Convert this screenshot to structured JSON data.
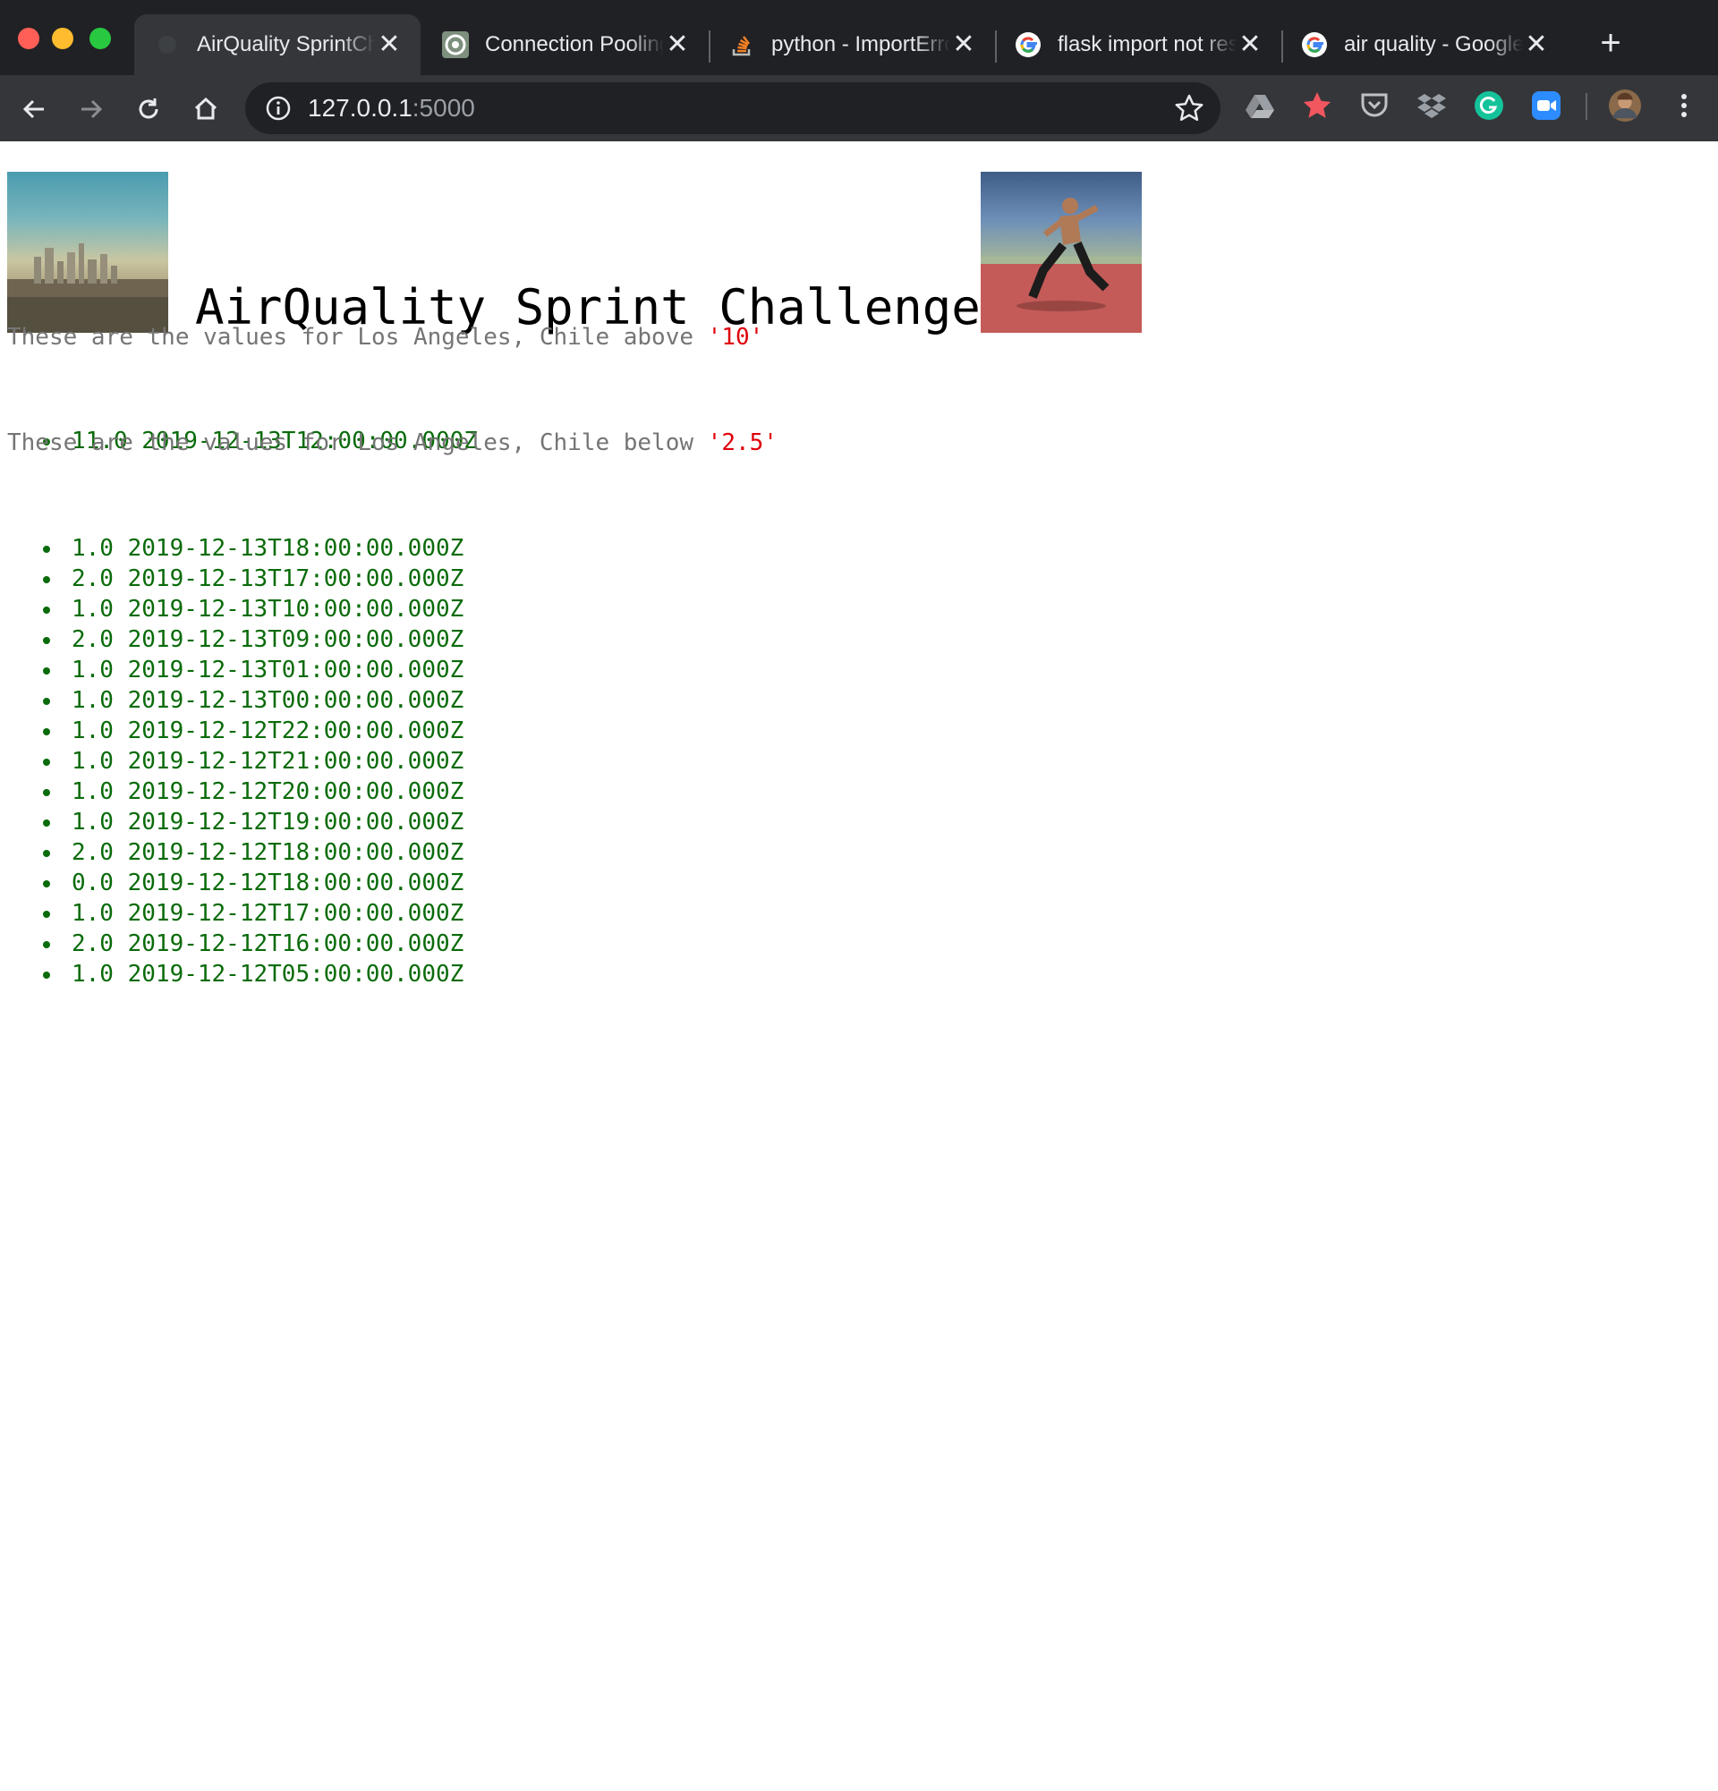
{
  "browser": {
    "tabs": [
      {
        "label": "AirQuality SprintChallenge",
        "active": true,
        "icon": "page-icon"
      },
      {
        "label": "Connection Pooling",
        "active": false,
        "icon": "target-icon"
      },
      {
        "label": "python - ImportError",
        "active": false,
        "icon": "stackoverflow-icon"
      },
      {
        "label": "flask import not resolved",
        "active": false,
        "icon": "google-icon"
      },
      {
        "label": "air quality - Google",
        "active": false,
        "icon": "google-icon"
      }
    ],
    "close_glyph": "✕",
    "new_tab_glyph": "+",
    "url_host": "127.0.0.1",
    "url_port": ":5000",
    "extensions": [
      "drive-icon",
      "bookmark-star-icon",
      "pocket-icon",
      "dropbox-icon",
      "grammarly-icon",
      "zoom-icon",
      "profile-avatar",
      "menu-dots-icon"
    ]
  },
  "page": {
    "heading": "AirQuality Sprint Challenge!",
    "above": {
      "prefix": "These are the values for Los Angeles, Chile above ",
      "threshold": "'10'",
      "items": [
        "11.0 2019-12-13T12:00:00.000Z"
      ]
    },
    "below": {
      "prefix": "These are the values for Los Angeles, Chile below ",
      "threshold": "'2.5'",
      "items": [
        "1.0 2019-12-13T18:00:00.000Z",
        "2.0 2019-12-13T17:00:00.000Z",
        "1.0 2019-12-13T10:00:00.000Z",
        "2.0 2019-12-13T09:00:00.000Z",
        "1.0 2019-12-13T01:00:00.000Z",
        "1.0 2019-12-13T00:00:00.000Z",
        "1.0 2019-12-12T22:00:00.000Z",
        "1.0 2019-12-12T21:00:00.000Z",
        "1.0 2019-12-12T20:00:00.000Z",
        "1.0 2019-12-12T19:00:00.000Z",
        "2.0 2019-12-12T18:00:00.000Z",
        "0.0 2019-12-12T18:00:00.000Z",
        "1.0 2019-12-12T17:00:00.000Z",
        "2.0 2019-12-12T16:00:00.000Z",
        "1.0 2019-12-12T05:00:00.000Z"
      ]
    }
  },
  "colors": {
    "threshold": "#e0000a",
    "value_text": "#0a6b0a",
    "paragraph_text": "#757575"
  }
}
